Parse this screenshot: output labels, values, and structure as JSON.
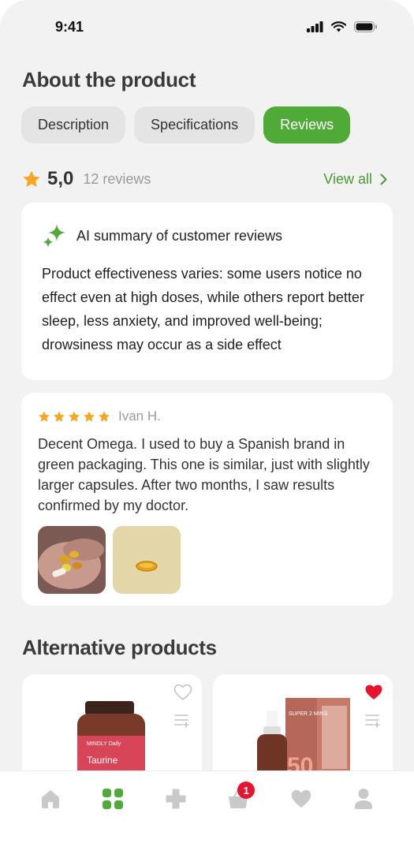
{
  "status_bar": {
    "time": "9:41"
  },
  "about": {
    "title": "About the product",
    "tabs": [
      {
        "label": "Description",
        "active": false
      },
      {
        "label": "Specifications",
        "active": false
      },
      {
        "label": "Reviews",
        "active": true
      }
    ]
  },
  "rating": {
    "value": "5,0",
    "count_text": "12 reviews",
    "view_all_label": "View all"
  },
  "ai_summary": {
    "title": "AI summary of customer reviews",
    "text": "Product effectiveness varies: some users notice no effect even at high doses, while others report better sleep, less anxiety, and improved well-being; drowsiness may occur as a side effect"
  },
  "review": {
    "stars": 5,
    "author": "Ivan H.",
    "text": "Decent Omega. I used to buy a Spanish brand in green packaging. This one is similar, just with slightly larger capsules. After two months, I saw results confirmed by my doctor."
  },
  "alternatives": {
    "title": "Alternative products",
    "products": [
      {
        "brand": "MINDLY Daily",
        "name": "Taurine",
        "favorited": false
      },
      {
        "brand": "SUPER 2 MINS",
        "name": "",
        "favorited": true
      }
    ]
  },
  "bottom_nav": {
    "items": [
      "home-icon",
      "catalog-icon",
      "pharmacy-cross-icon",
      "basket-icon",
      "heart-icon",
      "profile-icon"
    ],
    "active": "catalog-icon",
    "cart_badge": "1"
  },
  "colors": {
    "accent": "#4faa37",
    "star": "#f5a623",
    "favorite": "#e5142f",
    "background": "#f2f2f2"
  }
}
